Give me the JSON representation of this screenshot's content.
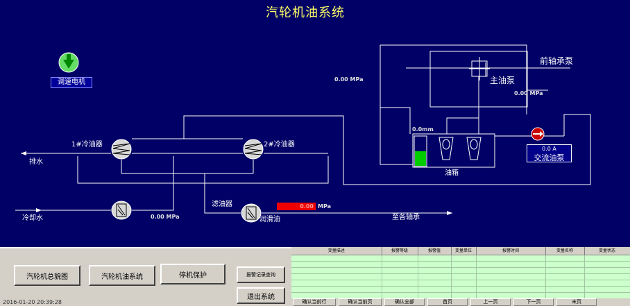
{
  "title": "汽轮机油系统",
  "motor_button": "调速电机",
  "labels": {
    "cooler1": "1#冷油器",
    "cooler2": "2#冷油器",
    "drain": "排水",
    "cooling_water": "冷却水",
    "filter": "滤油器",
    "lube_oil": "润滑油",
    "to_bearings": "至各轴承",
    "oil_tank": "油箱",
    "main_oil_pump": "主油泵",
    "front_bearing_pump": "前轴承泵"
  },
  "values": {
    "pressure_top": "0.00",
    "pressure_main_pump": "0.00",
    "tank_level": "0.0",
    "pressure_cooler": "0.00",
    "pressure_lube": "0.00",
    "ac_pump_current": "0.0"
  },
  "units": {
    "mpa": "MPa",
    "mm": "mm",
    "amp": "A"
  },
  "ac_pump_label": "交流油泵",
  "tank_level_fraction": 0.5,
  "panel": {
    "btn_overview": "汽轮机总貌图",
    "btn_oil": "汽轮机油系统",
    "btn_trip": "停机保护",
    "btn_alarm_query": "报警记录查询",
    "btn_exit": "退出系统",
    "clock": "2016-01-20 20:39:28"
  },
  "alarm": {
    "columns": [
      "变量描述",
      "报警等级",
      "报警值",
      "变量单位",
      "报警时间",
      "变量名称",
      "变量状态"
    ],
    "rows": 8,
    "buttons": [
      "确认当前行",
      "确认当前页",
      "确认全部",
      "首页",
      "上一页",
      "下一页",
      "末页"
    ]
  },
  "colors": {
    "background": "#000066",
    "title": "#ffff66",
    "tank_level": "#00cc00",
    "alarm_bg": "#ccffcc"
  },
  "icons": {
    "motor": "green-down-arrow-icon",
    "ac_pump": "red-arrow-icon"
  }
}
